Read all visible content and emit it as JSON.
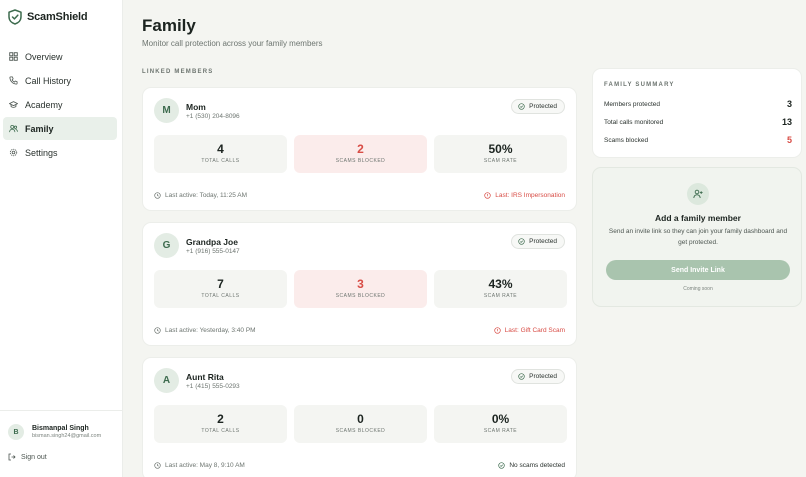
{
  "app": {
    "name": "ScamShield"
  },
  "sidebar": {
    "items": [
      {
        "label": "Overview",
        "icon": "grid-icon",
        "active": false
      },
      {
        "label": "Call History",
        "icon": "phone-icon",
        "active": false
      },
      {
        "label": "Academy",
        "icon": "graduation-cap-icon",
        "active": false
      },
      {
        "label": "Family",
        "icon": "users-icon",
        "active": true
      },
      {
        "label": "Settings",
        "icon": "gear-icon",
        "active": false
      }
    ],
    "user": {
      "initial": "B",
      "name": "Bismanpal Singh",
      "email": "bisman.singh24@gmail.com"
    },
    "signout": "Sign out"
  },
  "header": {
    "title": "Family",
    "subtitle": "Monitor call protection across your family members",
    "section_label": "LINKED MEMBERS"
  },
  "members": [
    {
      "initial": "M",
      "name": "Mom",
      "phone": "+1 (530) 204-8096",
      "badge": "Protected",
      "stats": [
        {
          "value": "4",
          "label": "TOTAL CALLS"
        },
        {
          "value": "2",
          "label": "SCAMS BLOCKED"
        },
        {
          "value": "50%",
          "label": "SCAM RATE"
        }
      ],
      "last_active": "Last active: Today, 11:25 AM",
      "last_event": "Last: IRS Impersonation"
    },
    {
      "initial": "G",
      "name": "Grandpa Joe",
      "phone": "+1 (916) 555-0147",
      "badge": "Protected",
      "stats": [
        {
          "value": "7",
          "label": "TOTAL CALLS"
        },
        {
          "value": "3",
          "label": "SCAMS BLOCKED"
        },
        {
          "value": "43%",
          "label": "SCAM RATE"
        }
      ],
      "last_active": "Last active: Yesterday, 3:40 PM",
      "last_event": "Last: Gift Card Scam"
    },
    {
      "initial": "A",
      "name": "Aunt Rita",
      "phone": "+1 (415) 555-0293",
      "badge": "Protected",
      "stats": [
        {
          "value": "2",
          "label": "TOTAL CALLS"
        },
        {
          "value": "0",
          "label": "SCAMS BLOCKED"
        },
        {
          "value": "0%",
          "label": "SCAM RATE"
        }
      ],
      "last_active": "Last active: May 8, 9:10 AM",
      "last_event": "No scams detected"
    }
  ],
  "summary": {
    "title": "FAMILY SUMMARY",
    "rows": [
      {
        "label": "Members protected",
        "value": "3"
      },
      {
        "label": "Total calls monitored",
        "value": "13"
      },
      {
        "label": "Scams blocked",
        "value": "5"
      }
    ]
  },
  "invite": {
    "title": "Add a family member",
    "text": "Send an invite link so they can join your family dashboard and get protected.",
    "button": "Send Invite Link",
    "note": "Coming soon"
  },
  "colors": {
    "accent": "#3d6b4e",
    "danger": "#d84c45",
    "button": "#a9c4ae"
  }
}
